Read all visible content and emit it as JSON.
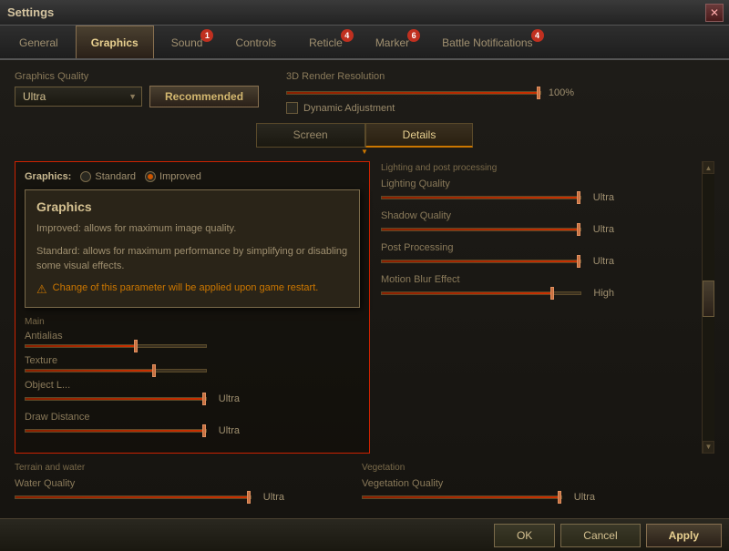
{
  "window": {
    "title": "Settings",
    "close_label": "✕"
  },
  "tabs": [
    {
      "id": "general",
      "label": "General",
      "badge": null,
      "active": false
    },
    {
      "id": "graphics",
      "label": "Graphics",
      "badge": null,
      "active": true
    },
    {
      "id": "sound",
      "label": "Sound",
      "badge": "1",
      "active": false
    },
    {
      "id": "controls",
      "label": "Controls",
      "badge": null,
      "active": false
    },
    {
      "id": "reticle",
      "label": "Reticle",
      "badge": "4",
      "active": false
    },
    {
      "id": "marker",
      "label": "Marker",
      "badge": "6",
      "active": false
    },
    {
      "id": "battle_notifications",
      "label": "Battle Notifications",
      "badge": "4",
      "active": false
    }
  ],
  "graphics": {
    "quality_label": "Graphics Quality",
    "quality_value": "Ultra",
    "recommended_label": "Recommended",
    "render_label": "3D Render Resolution",
    "render_value": "100%",
    "dynamic_adj_label": "Dynamic Adjustment",
    "sub_tab_screen": "Screen",
    "sub_tab_details": "Details",
    "graphics_mode_label": "Graphics:",
    "mode_standard": "Standard",
    "mode_improved": "Improved",
    "tooltip": {
      "title": "Graphics",
      "text1": "Improved: allows for maximum image quality.",
      "text2": "Standard: allows for maximum performance by simplifying or disabling some visual effects.",
      "warning": "Change of this parameter will be applied upon game restart."
    },
    "left_section": {
      "main_label": "Main",
      "antialiasing_label": "Antialias",
      "texture_label": "Texture",
      "object_lod_label": "Object L...",
      "object_lod_value": "Ultra",
      "draw_distance_label": "Draw Distance",
      "draw_distance_value": "Ultra"
    },
    "right_section": {
      "lighting_label": "Lighting and post processing",
      "lighting_quality_label": "Lighting Quality",
      "lighting_quality_value": "Ultra",
      "shadow_quality_label": "Shadow Quality",
      "shadow_quality_value": "Ultra",
      "post_processing_label": "Post Processing",
      "post_processing_value": "Ultra",
      "motion_blur_label": "Motion Blur Effect",
      "motion_blur_value": "High"
    },
    "terrain_left": {
      "section_label": "Terrain and water",
      "water_quality_label": "Water Quality",
      "water_quality_value": "Ultra"
    },
    "terrain_right": {
      "section_label": "Vegetation",
      "vegetation_quality_label": "Vegetation Quality",
      "vegetation_quality_value": "Ultra"
    }
  },
  "bottom": {
    "ok_label": "OK",
    "cancel_label": "Cancel",
    "apply_label": "Apply"
  }
}
